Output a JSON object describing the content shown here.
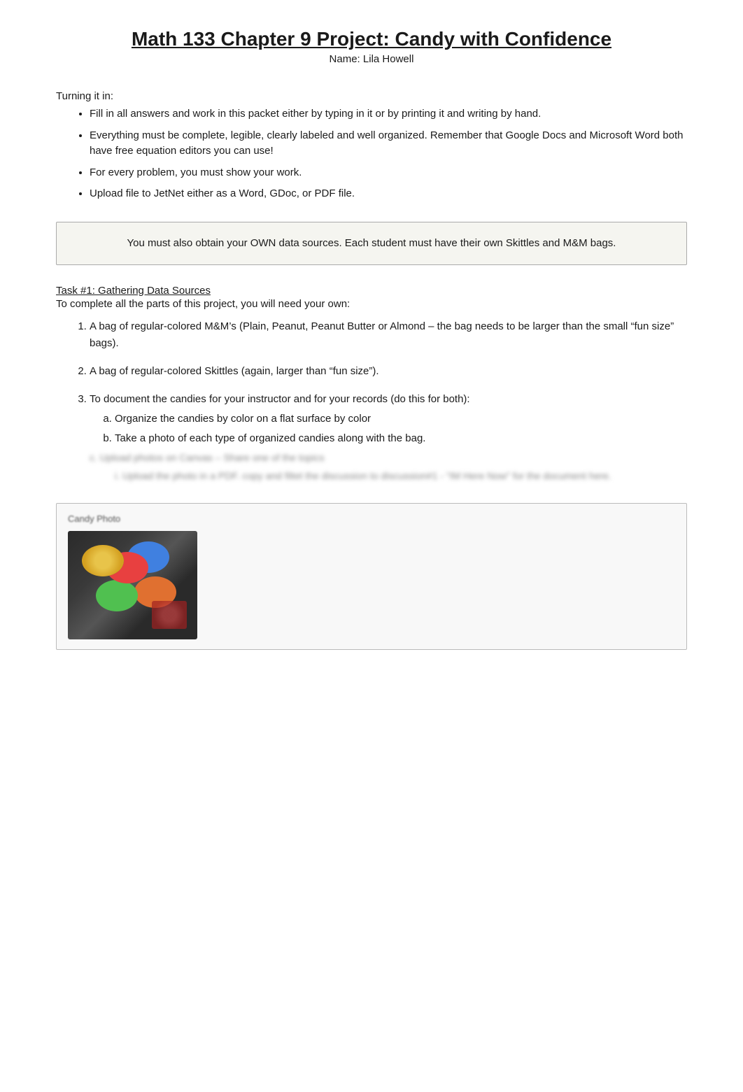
{
  "header": {
    "title": "Math 133 Chapter 9 Project:   Candy with Confidence",
    "name_label": "Name:  Lila Howell"
  },
  "turning_in": {
    "label": "Turning it in:",
    "bullets": [
      "Fill in all answers and work in this packet either by typing in it or by printing it and writing by hand.",
      "Everything must be complete, legible, clearly labeled and well organized. Remember that Google Docs and Microsoft Word both have free equation editors   you can use!",
      "For every problem, you must show your work.",
      "Upload file to JetNet either as a Word, GDoc, or PDF file."
    ]
  },
  "notice": {
    "text": "You must also obtain your OWN data sources. Each student must have their own Skittles and M&M bags."
  },
  "task1": {
    "header": "Task #1: Gathering Data Sources",
    "intro": "To complete all the parts of this project, you will need your own:",
    "items": [
      {
        "id": 1,
        "text": "A bag of regular-colored  M&M’s (Plain, Peanut, Peanut Butter or Almond – the bag needs to be larger than the small “fun size” bags)."
      },
      {
        "id": 2,
        "text": "A bag of regular-colored  Skittles (again, larger than “fun size”)."
      },
      {
        "id": 3,
        "text": "To document the candies for your instructor and for your records (do this for both):",
        "sub_items": [
          "Organize  the candies by color on a flat surface by color",
          "Take a photo  of each type of organized candies along with the bag."
        ],
        "blurred_c": "c.  Upload photos on Canvas   – Share one of the topics",
        "blurred_d": "i.  Upload the photo in a PDF.   copy and filtet the discussion to discussion#1 - “IM Here Now”  for the document here."
      }
    ]
  },
  "image_section": {
    "label": "Candy Photo",
    "alt": "Photo of organized candies by color"
  }
}
